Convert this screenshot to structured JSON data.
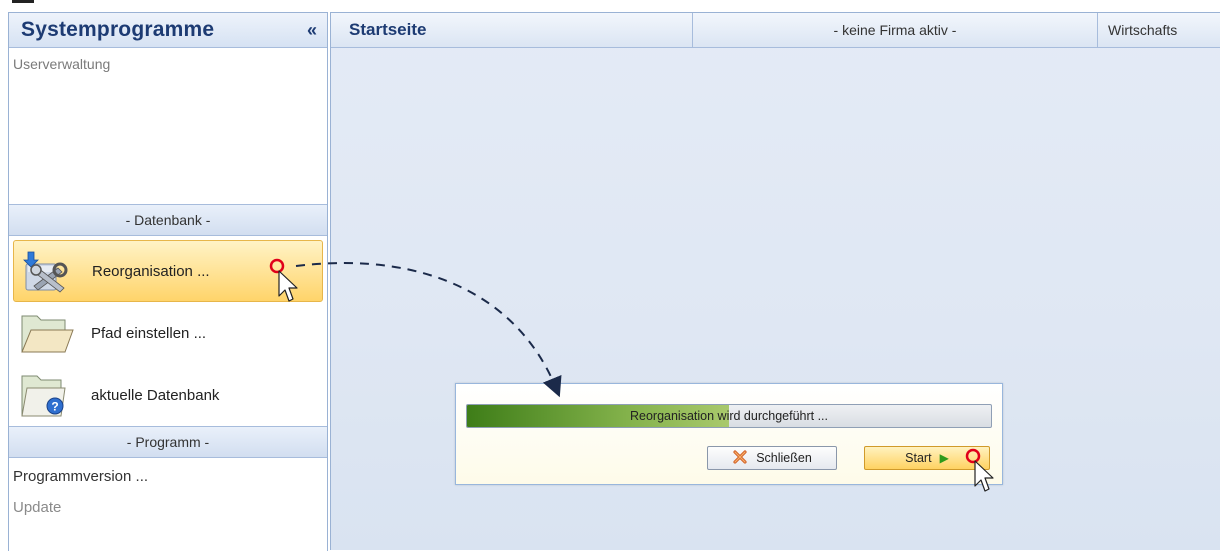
{
  "sidebar": {
    "title": "Systemprogramme",
    "collapse_glyph": "«",
    "top_items": [
      "Userverwaltung"
    ],
    "group_db": "- Datenbank -",
    "actions": [
      {
        "label": "Reorganisation ...",
        "icon": "reorganize-tools-icon"
      },
      {
        "label": "Pfad einstellen ...",
        "icon": "folder-icon"
      },
      {
        "label": "aktuelle Datenbank",
        "icon": "database-info-icon"
      }
    ],
    "group_prog": "- Programm -",
    "prog_items": [
      "Programmversion ...",
      "Update"
    ]
  },
  "tabs": {
    "main": "Startseite",
    "firm": "- keine Firma aktiv -",
    "wirt": "Wirtschafts"
  },
  "dialog": {
    "progress_text": "Reorganisation wird durchgeführt ...",
    "progress": 0.5,
    "close_label": "Schließen",
    "start_label": "Start"
  },
  "colors": {
    "accent": "#1d3b73",
    "selected": "#ffd46a",
    "progress": "#5e9a2e",
    "highlight_ring": "#e0001a"
  }
}
